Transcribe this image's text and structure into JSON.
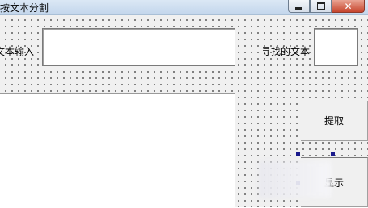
{
  "window": {
    "title": "按文本分割"
  },
  "controls": {
    "input_label": "文本输入",
    "input_value": "",
    "find_label": "寻找的文本",
    "find_value": "",
    "extract_button": "提取",
    "display_button": "显示"
  }
}
